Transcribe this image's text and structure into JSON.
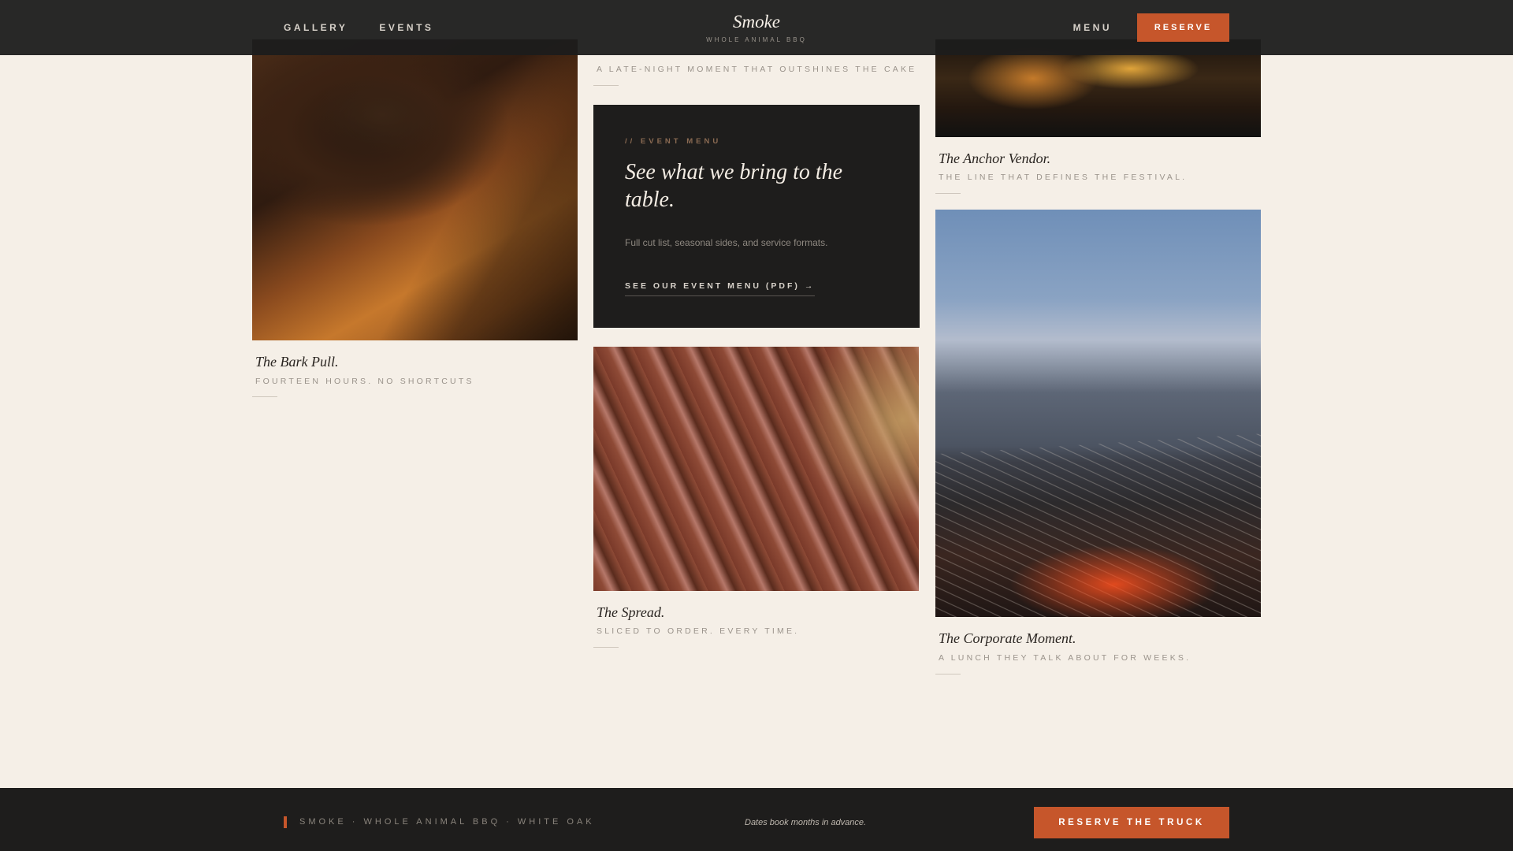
{
  "header": {
    "nav_left": [
      "GALLERY",
      "EVENTS"
    ],
    "brand_title": "Smoke",
    "brand_subtitle": "WHOLE ANIMAL BBQ",
    "menu_label": "MENU",
    "reserve_label": "RESERVE"
  },
  "gallery": {
    "bark": {
      "title": "The Bark Pull.",
      "subtitle": "FOURTEEN HOURS. NO SHORTCUTS"
    },
    "late_night": {
      "subtitle": "A LATE-NIGHT MOMENT THAT OUTSHINES THE CAKE"
    },
    "anchor": {
      "title": "The Anchor Vendor.",
      "subtitle": "THE LINE THAT DEFINES THE FESTIVAL."
    },
    "spread": {
      "title": "The Spread.",
      "subtitle": "SLICED TO ORDER. EVERY TIME."
    },
    "corporate": {
      "title": "The Corporate Moment.",
      "subtitle": "A LUNCH THEY TALK ABOUT FOR WEEKS."
    }
  },
  "event_menu": {
    "kicker": "// EVENT MENU",
    "title": "See what we bring to the table.",
    "description": "Full cut list, seasonal sides, and service formats.",
    "link": "SEE OUR EVENT MENU (PDF) →"
  },
  "footer": {
    "tagline": "SMOKE · WHOLE ANIMAL BBQ · WHITE OAK",
    "note": "Dates book months in advance.",
    "cta": "RESERVE THE TRUCK"
  },
  "colors": {
    "accent": "#c6562b",
    "background": "#f5efe7",
    "dark": "#1e1d1c"
  }
}
